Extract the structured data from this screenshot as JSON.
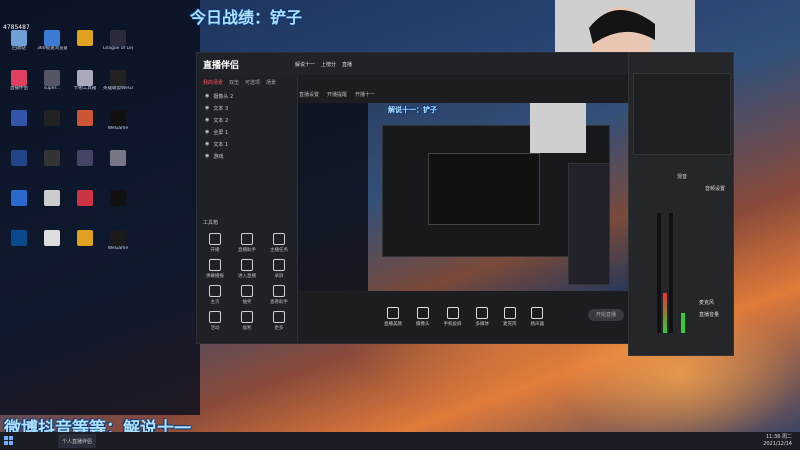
{
  "overlay": {
    "top_title": "今日战绩：铲子",
    "bottom_banner": "微博抖音等等：解说十一",
    "user_id": "4785487"
  },
  "desktop_icons": [
    {
      "label": "回收站",
      "color": "#6fa0d8"
    },
    {
      "label": "360极速浏览器",
      "color": "#3b7bd4"
    },
    {
      "label": "",
      "color": "#e0a020"
    },
    {
      "label": "League of Legends",
      "color": "#2a2a3a"
    },
    {
      "label": "直播伴侣",
      "color": "#e04060"
    },
    {
      "label": "super...",
      "color": "#556"
    },
    {
      "label": "卡顿工具箱",
      "color": "#aab"
    },
    {
      "label": "英雄联盟WeGame",
      "color": "#222"
    },
    {
      "label": "",
      "color": "#3355aa"
    },
    {
      "label": "",
      "color": "#222"
    },
    {
      "label": "",
      "color": "#cc5533"
    },
    {
      "label": "WeGame",
      "color": "#111"
    },
    {
      "label": "",
      "color": "#224488"
    },
    {
      "label": "",
      "color": "#333"
    },
    {
      "label": "",
      "color": "#446"
    },
    {
      "label": "",
      "color": "#778"
    },
    {
      "label": "",
      "color": "#2a6acc"
    },
    {
      "label": "",
      "color": "#ccc"
    },
    {
      "label": "",
      "color": "#cc3344"
    },
    {
      "label": "",
      "color": "#111"
    },
    {
      "label": "",
      "color": "#0a4a8a"
    },
    {
      "label": "",
      "color": "#ddd"
    },
    {
      "label": "",
      "color": "#e0a020"
    },
    {
      "label": "WeGame",
      "color": "#1a1a1a"
    }
  ],
  "app": {
    "logo": "直播伴侣",
    "header_items": [
      "解说十一",
      "上榜分",
      "直播"
    ],
    "sub_items": [
      "直播设置",
      "开播提醒",
      "开播十一"
    ],
    "tabs": [
      "我的场景",
      "双击",
      "可选项",
      "场景"
    ],
    "scenes": [
      "摄像头 2",
      "文本 3",
      "文本 2",
      "全屏 1",
      "文本 1",
      "游戏"
    ],
    "tools_title": "工具箱",
    "tools": [
      "开播",
      "直播助手",
      "主播任务",
      "弹幕播报",
      "进入直播",
      "录屏",
      "主页",
      "抽奖",
      "查看助手",
      "活动",
      "福利",
      "更多"
    ],
    "preview_caption": "解说十一：铲子",
    "bottom_buttons": [
      "直播美颜",
      "摄像头",
      "手机投屏",
      "多媒体",
      "麦克风",
      "扬声器"
    ],
    "go_live": "开始直播"
  },
  "mixer": {
    "labels": [
      "混音",
      "音频设置",
      "麦克风",
      "直播音量"
    ]
  },
  "taskbar": {
    "items": [
      "",
      "",
      "个人直播伴侣",
      "",
      "",
      "",
      ""
    ],
    "time": "11:36 周二",
    "date": "2021/12/14"
  }
}
